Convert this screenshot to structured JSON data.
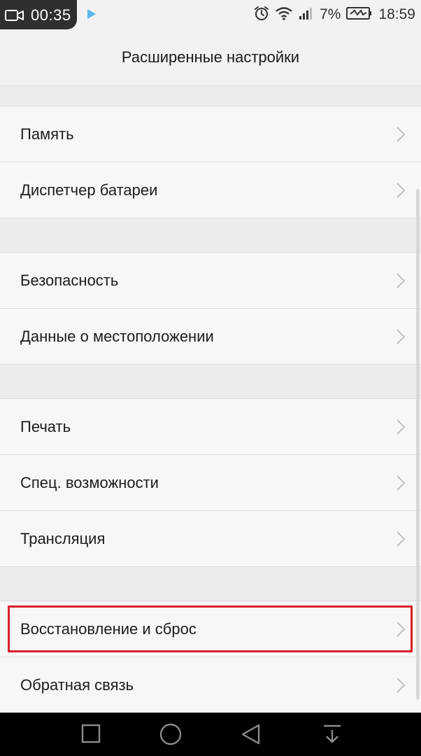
{
  "status_bar": {
    "recording_time": "00:35",
    "battery": "7%",
    "clock": "18:59"
  },
  "header": {
    "title": "Расширенные настройки"
  },
  "items": [
    {
      "label": "Память"
    },
    {
      "label": "Диспетчер батареи"
    },
    {
      "label": "Безопасность"
    },
    {
      "label": "Данные о местоположении"
    },
    {
      "label": "Печать"
    },
    {
      "label": "Спец. возможности"
    },
    {
      "label": "Трансляция"
    },
    {
      "label": "Восстановление и сброс"
    },
    {
      "label": "Обратная связь"
    }
  ],
  "colors": {
    "highlight": "#d9202a",
    "background": "#f2f2f2",
    "nav_bar": "#000000"
  },
  "icons": [
    "video-camera-icon",
    "play-store-icon",
    "alarm-icon",
    "wifi-icon",
    "signal-icon",
    "battery-charging-icon",
    "chevron-right-icon",
    "recent-apps-icon",
    "home-icon",
    "back-icon",
    "notifications-pull-icon"
  ]
}
